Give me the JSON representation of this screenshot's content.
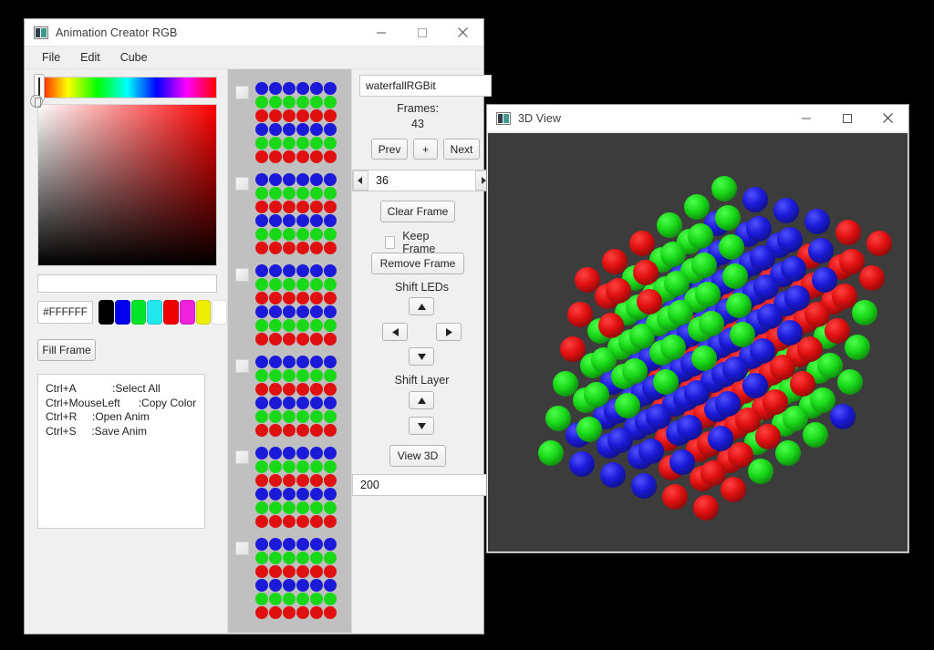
{
  "desktop": {
    "background": "#000000"
  },
  "main_window": {
    "title": "Animation Creator RGB",
    "icon": "app-icon",
    "controls": {
      "minimize": "minimize-icon",
      "maximize": "maximize-icon",
      "close": "close-icon"
    },
    "menubar": [
      {
        "label": "File"
      },
      {
        "label": "Edit"
      },
      {
        "label": "Cube"
      }
    ],
    "color_picker": {
      "hex_value": "#FFFFFF",
      "preview_color": "#ffffff",
      "swatches": [
        "#000000",
        "#0000ee",
        "#00e52a",
        "#22e8ee",
        "#ee0000",
        "#ee22dd",
        "#eeee00",
        "#ffffff"
      ],
      "fill_button": "Fill Frame"
    },
    "shortcuts_text": "Ctrl+A            :Select All\nCtrl+MouseLeft      :Copy Color\nCtrl+R     :Open Anim\nCtrl+S     :Save Anim",
    "controls_panel": {
      "animation_name": "waterfallRGBit",
      "frames_label": "Frames:",
      "frames_count": "43",
      "prev_button": "Prev",
      "add_button": "+",
      "next_button": "Next",
      "current_frame": "36",
      "spin_left": "◀",
      "spin_right": "▶",
      "clear_frame_button": "Clear Frame",
      "keep_frame_label": "Keep Frame",
      "keep_frame_checked": false,
      "remove_frame_button": "Remove Frame",
      "shift_leds_label": "Shift LEDs",
      "shift_layer_label": "Shift Layer",
      "view_3d_button": "View 3D",
      "delay_value": "200"
    },
    "frame_list": {
      "row_colors": [
        "#1a1ad8",
        "#18d818",
        "#e01010",
        "#1a1ad8",
        "#18d818",
        "#e01010"
      ],
      "columns": 6,
      "blocks": [
        {
          "checked": false
        },
        {
          "checked": false
        },
        {
          "checked": false
        },
        {
          "checked": false
        },
        {
          "checked": false
        },
        {
          "checked": false
        }
      ]
    }
  },
  "view3d_window": {
    "title": "3D View",
    "icon": "app-icon",
    "controls": {
      "minimize": "minimize-icon",
      "maximize": "maximize-icon",
      "close": "close-icon"
    },
    "canvas_background": "#3c3c3c",
    "cube": {
      "size": 6,
      "colors": {
        "R": "#e01010",
        "G": "#18d818",
        "B": "#1a1ad8"
      },
      "description": "6x6x6 RGB LED cube showing diagonal red/green/blue waterfall bands"
    }
  }
}
